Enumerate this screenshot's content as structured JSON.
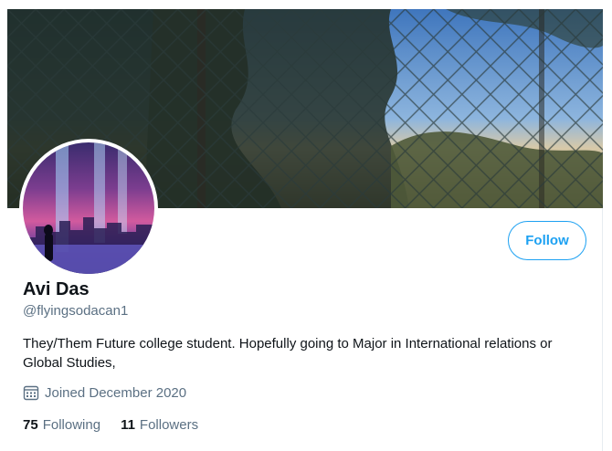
{
  "profile": {
    "display_name": "Avi Das",
    "handle": "@flyingsodacan1",
    "bio": "They/Them Future college student. Hopefully going to Major in International relations or Global Studies,",
    "joined": "Joined December 2020",
    "follow_label": "Follow",
    "stats": {
      "following_count": "75",
      "following_label": "Following",
      "followers_count": "11",
      "followers_label": "Followers"
    }
  },
  "icons": {
    "joined": "calendar-icon"
  },
  "colors": {
    "accent": "#1da1f2",
    "secondary_text": "#5b7083",
    "primary_text": "#0f1419"
  }
}
